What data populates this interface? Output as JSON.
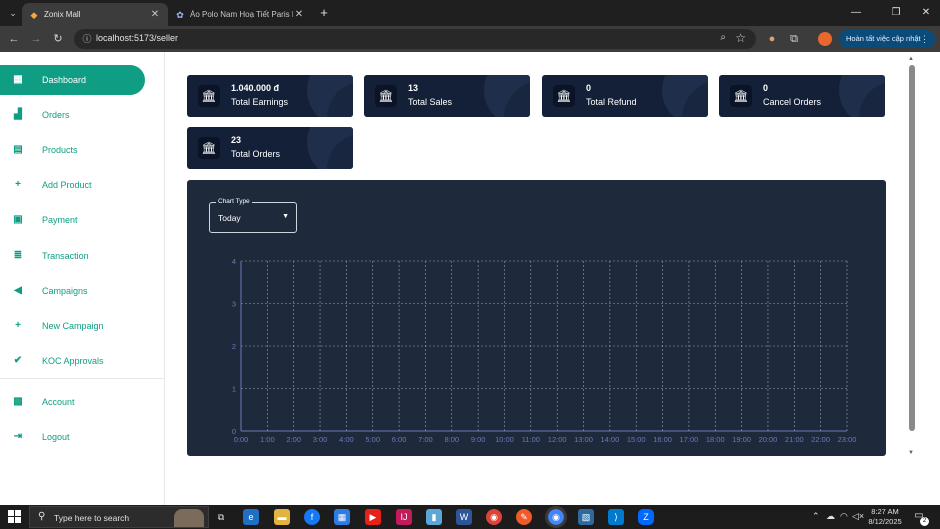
{
  "browser": {
    "tabs": [
      {
        "title": "Zonix Mall",
        "active": true
      },
      {
        "title": "Áo Polo Nam Hoạ Tiết Paris Fo",
        "active": false
      }
    ],
    "url": "localhost:5173/seller",
    "update_label": "Hoàn tất việc cập nhật"
  },
  "sidebar": {
    "items": [
      {
        "label": "Dashboard",
        "icon": "dashboard-icon",
        "glyph": "▦",
        "active": true
      },
      {
        "label": "Orders",
        "icon": "bag-icon",
        "glyph": "▟"
      },
      {
        "label": "Products",
        "icon": "box-icon",
        "glyph": "▤"
      },
      {
        "label": "Add Product",
        "icon": "plus-icon",
        "glyph": "+"
      },
      {
        "label": "Payment",
        "icon": "wallet-icon",
        "glyph": "▣"
      },
      {
        "label": "Transaction",
        "icon": "list-icon",
        "glyph": "≣"
      },
      {
        "label": "Campaigns",
        "icon": "megaphone-icon",
        "glyph": "◀"
      },
      {
        "label": "New Campaign",
        "icon": "plus-icon",
        "glyph": "+"
      },
      {
        "label": "KOC Approvals",
        "icon": "user-check-icon",
        "glyph": "✔"
      },
      {
        "label": "Account",
        "icon": "account-icon",
        "glyph": "▩"
      },
      {
        "label": "Logout",
        "icon": "logout-icon",
        "glyph": "⇥"
      }
    ]
  },
  "stats": [
    {
      "value": "1.040.000 đ",
      "label": "Total Earnings"
    },
    {
      "value": "13",
      "label": "Total Sales"
    },
    {
      "value": "0",
      "label": "Total Refund"
    },
    {
      "value": "0",
      "label": "Cancel Orders"
    },
    {
      "value": "23",
      "label": "Total Orders"
    }
  ],
  "chart_controls": {
    "legend": "Chart Type",
    "selected": "Today"
  },
  "chart_data": {
    "type": "line",
    "categories": [
      "0:00",
      "1:00",
      "2:00",
      "3:00",
      "4:00",
      "5:00",
      "6:00",
      "7:00",
      "8:00",
      "9:00",
      "10:00",
      "11:00",
      "12:00",
      "13:00",
      "14:00",
      "15:00",
      "16:00",
      "17:00",
      "18:00",
      "19:00",
      "20:00",
      "21:00",
      "22:00",
      "23:00"
    ],
    "series": [],
    "ylim": [
      0,
      4
    ],
    "yticks": [
      "0",
      "1",
      "2",
      "3",
      "4"
    ],
    "grid": true,
    "colors": {
      "axis": "#6b7ab8",
      "grid": "#cbd5e1",
      "panel": "#1e293b"
    }
  },
  "taskbar": {
    "search_placeholder": "Type here to search",
    "time": "8:27 AM",
    "date": "8/12/2025",
    "notification_count": "2"
  }
}
